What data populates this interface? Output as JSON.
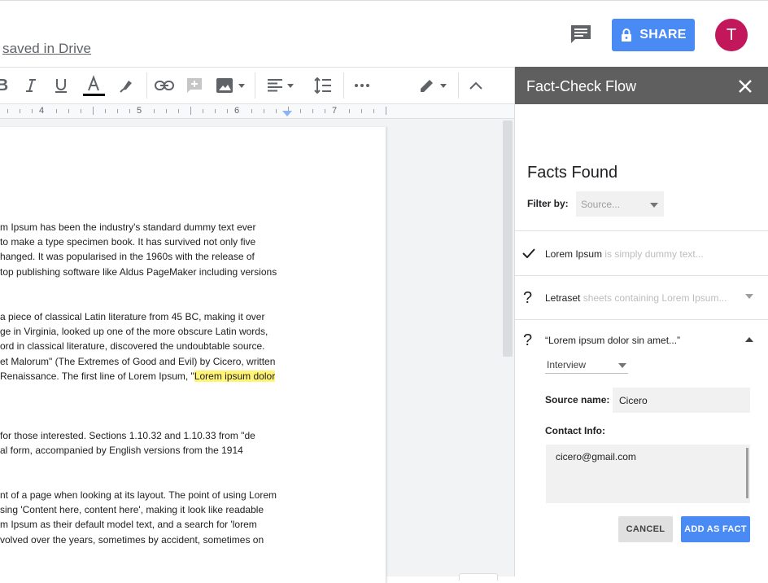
{
  "header": {
    "saved_text": "saved in Drive",
    "share_label": "SHARE",
    "avatar_initial": "T",
    "share_color": "#4a8af4",
    "avatar_color": "#c2185b"
  },
  "toolbar": {
    "icons": [
      "bold-icon",
      "italic-icon",
      "underline-icon",
      "text-color-icon",
      "highlight-icon",
      "link-icon",
      "insert-comment-icon",
      "image-icon",
      "align-icon",
      "line-spacing-icon",
      "more-icon",
      "editing-mode-icon",
      "collapse-icon"
    ]
  },
  "ruler": {
    "numbers": [
      "4",
      "5",
      "6",
      "7"
    ]
  },
  "document": {
    "paragraphs": [
      [
        "m Ipsum has been the industry's standard dummy text ever",
        " to make a type specimen book. It has survived not only five",
        "hanged. It was popularised in the 1960s with the release of",
        "top publishing software like Aldus PageMaker including versions"
      ],
      [
        "a piece of classical Latin literature from 45 BC, making it over",
        "ge in Virginia, looked up one of the more obscure Latin words,",
        "ord in classical literature, discovered the undoubtable source.",
        "et Malorum\" (The Extremes of Good and Evil) by Cicero, written"
      ],
      [
        "for those interested. Sections 1.10.32 and 1.10.33 from \"de",
        "al form, accompanied by English versions from the 1914"
      ],
      [
        "nt of a page when looking at its layout. The point of using Lorem",
        "sing 'Content here, content here', making it look like readable",
        "m Ipsum as their default model text, and a search for 'lorem",
        "volved over the years, sometimes by accident, sometimes on"
      ]
    ],
    "renaissance_line": "Renaissance. The first line of Lorem Ipsum, \"",
    "highlighted": "Lorem ipsum dolor"
  },
  "panel": {
    "title": "Fact-Check Flow",
    "facts_title": "Facts Found",
    "filter_label": "Filter by:",
    "filter_placeholder": "Source...",
    "facts": [
      {
        "icon": "✓",
        "name": "Lorem Ipsum",
        "desc": " is simply dummy text..."
      },
      {
        "icon": "?",
        "name": "Letraset",
        "desc": " sheets containing Lorem Ipsum..."
      },
      {
        "icon": "?",
        "name": "“Lorem ipsum dolor sin amet...”",
        "desc": ""
      }
    ],
    "source_type": "Interview",
    "source_name_label": "Source name:",
    "source_name_value": "Cicero",
    "contact_label": "Contact Info:",
    "contact_value": "cicero@gmail.com",
    "cancel_label": "CANCEL",
    "add_label": "ADD AS FACT"
  }
}
